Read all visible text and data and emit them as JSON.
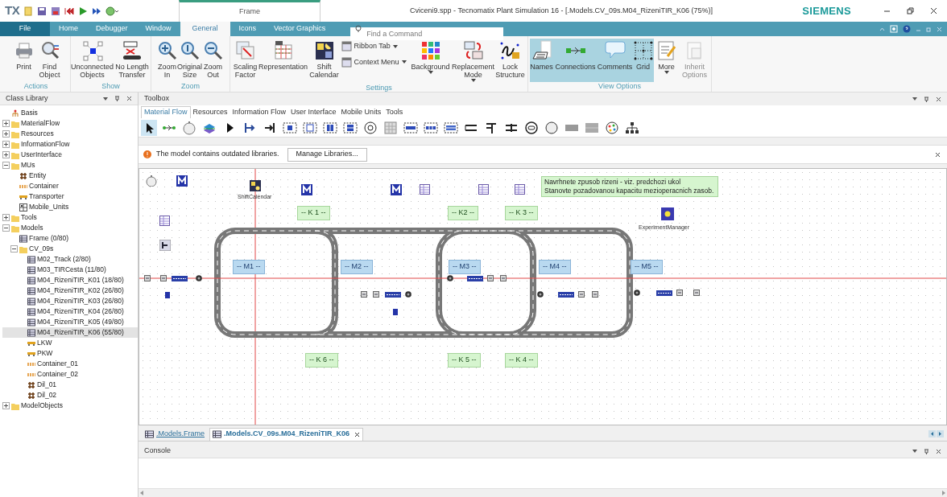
{
  "title_bar": {
    "logo": "TX",
    "contextual_tab": "Frame",
    "title": "Cviceni9.spp - Tecnomatix Plant Simulation 16 - [.Models.CV_09s.M04_RizeniTIR_K06  (75%)]",
    "brand": "SIEMENS"
  },
  "ribbon": {
    "tabs": [
      {
        "label": "File",
        "kind": "file",
        "selected": false
      },
      {
        "label": "Home",
        "kind": "tab",
        "selected": false
      },
      {
        "label": "Debugger",
        "kind": "tab",
        "selected": false
      },
      {
        "label": "Window",
        "kind": "tab",
        "selected": false
      },
      {
        "label": "General",
        "kind": "tab",
        "selected": true
      },
      {
        "label": "Icons",
        "kind": "tab",
        "selected": false
      },
      {
        "label": "Vector Graphics",
        "kind": "tab",
        "selected": false
      }
    ],
    "search": {
      "placeholder": "Find a Command"
    },
    "groups": [
      {
        "label": "Actions",
        "items": [
          {
            "kind": "large",
            "label": "Print"
          },
          {
            "kind": "large",
            "label": "Find Object"
          }
        ]
      },
      {
        "label": "Show",
        "items": [
          {
            "kind": "large",
            "label": "Unconnected Objects"
          },
          {
            "kind": "large",
            "label": "No Length Transfer"
          }
        ]
      },
      {
        "label": "Zoom",
        "items": [
          {
            "kind": "large",
            "label": "Zoom In"
          },
          {
            "kind": "large",
            "label": "Original Size"
          },
          {
            "kind": "large",
            "label": "Zoom Out"
          }
        ]
      },
      {
        "label": "Settings",
        "items": [
          {
            "kind": "large",
            "label": "Scaling Factor"
          },
          {
            "kind": "large",
            "label": "Representation"
          },
          {
            "kind": "large",
            "label": "Shift Calendar"
          },
          {
            "kind": "small",
            "label": "Ribbon Tab"
          },
          {
            "kind": "small",
            "label": "Context Menu"
          },
          {
            "kind": "large-dropdown",
            "label": "Background"
          },
          {
            "kind": "large-dropdown",
            "label": "Replacement Mode"
          },
          {
            "kind": "large",
            "label": "Lock Structure"
          }
        ]
      },
      {
        "label": "View Options",
        "items": [
          {
            "kind": "large",
            "label": "Names",
            "selected": true,
            "disabled": false
          },
          {
            "kind": "large",
            "label": "Connections",
            "selected": true,
            "disabled": false
          },
          {
            "kind": "large",
            "label": "Comments",
            "selected": true,
            "disabled": false
          },
          {
            "kind": "large",
            "label": "Grid",
            "selected": true,
            "disabled": false
          },
          {
            "kind": "large-dropdown",
            "label": "More",
            "selected": false,
            "disabled": false
          },
          {
            "kind": "large",
            "label": "Inherit Options",
            "selected": false,
            "disabled": true
          }
        ]
      }
    ]
  },
  "class_library": {
    "title": "Class Library",
    "tree": [
      {
        "label": "Basis",
        "kind": "library",
        "selected": false
      },
      {
        "label": "MaterialFlow",
        "kind": "folder",
        "expanded": false,
        "selected": false
      },
      {
        "label": "Resources",
        "kind": "folder",
        "expanded": false,
        "selected": false
      },
      {
        "label": "InformationFlow",
        "kind": "folder",
        "expanded": false,
        "selected": false
      },
      {
        "label": "UserInterface",
        "kind": "folder",
        "expanded": false,
        "selected": false
      },
      {
        "label": "MUs",
        "kind": "folder",
        "expanded": true,
        "selected": false,
        "children": [
          {
            "label": "Entity",
            "kind": "entity",
            "selected": false
          },
          {
            "label": "Container",
            "kind": "container",
            "selected": false
          },
          {
            "label": "Transporter",
            "kind": "transporter",
            "selected": false
          },
          {
            "label": "Mobile_Units",
            "kind": "mu-folder",
            "selected": false
          }
        ]
      },
      {
        "label": "Tools",
        "kind": "folder",
        "expanded": false,
        "selected": false
      },
      {
        "label": "Models",
        "kind": "folder",
        "expanded": true,
        "selected": false,
        "children": [
          {
            "label": "Frame (0/80)",
            "kind": "frame",
            "selected": false
          },
          {
            "label": "CV_09s",
            "kind": "folder",
            "expanded": true,
            "selected": false,
            "children": [
              {
                "label": "M02_Track (2/80)",
                "kind": "frame",
                "selected": false
              },
              {
                "label": "M03_TIRCesta (11/80)",
                "kind": "frame",
                "selected": false
              },
              {
                "label": "M04_RizeniTIR_K01 (18/80)",
                "kind": "frame",
                "selected": false
              },
              {
                "label": "M04_RizeniTIR_K02 (26/80)",
                "kind": "frame",
                "selected": false
              },
              {
                "label": "M04_RizeniTIR_K03 (26/80)",
                "kind": "frame",
                "selected": false
              },
              {
                "label": "M04_RizeniTIR_K04 (26/80)",
                "kind": "frame",
                "selected": false
              },
              {
                "label": "M04_RizeniTIR_K05 (49/80)",
                "kind": "frame",
                "selected": false
              },
              {
                "label": "M04_RizeniTIR_K06 (55/80)",
                "kind": "frame",
                "selected": true
              },
              {
                "label": "LKW",
                "kind": "transporter",
                "selected": false
              },
              {
                "label": "PKW",
                "kind": "transporter",
                "selected": false
              },
              {
                "label": "Container_01",
                "kind": "container",
                "selected": false
              },
              {
                "label": "Container_02",
                "kind": "container",
                "selected": false
              },
              {
                "label": "Dil_01",
                "kind": "entity",
                "selected": false
              },
              {
                "label": "Dil_02",
                "kind": "entity",
                "selected": false
              }
            ]
          }
        ]
      },
      {
        "label": "ModelObjects",
        "kind": "folder",
        "expanded": false,
        "selected": false
      }
    ]
  },
  "toolbox": {
    "title": "Toolbox",
    "tabs": [
      {
        "label": "Material Flow",
        "selected": true
      },
      {
        "label": "Resources",
        "selected": false
      },
      {
        "label": "Information Flow",
        "selected": false
      },
      {
        "label": "User Interface",
        "selected": false
      },
      {
        "label": "Mobile Units",
        "selected": false
      },
      {
        "label": "Tools",
        "selected": false
      }
    ],
    "tools": [
      {
        "selected": true
      },
      {
        "selected": false
      },
      {
        "selected": false
      },
      {
        "selected": false
      },
      {
        "selected": false
      },
      {
        "selected": false
      },
      {
        "selected": false
      },
      {
        "selected": false
      },
      {
        "selected": false
      },
      {
        "selected": false
      },
      {
        "selected": false
      },
      {
        "selected": false
      },
      {
        "selected": false
      },
      {
        "selected": false
      },
      {
        "selected": false
      },
      {
        "selected": false
      },
      {
        "selected": false
      },
      {
        "selected": false
      },
      {
        "selected": false
      },
      {
        "selected": false
      },
      {
        "selected": false
      },
      {
        "selected": false
      },
      {
        "selected": false
      },
      {
        "selected": false
      },
      {
        "selected": false
      }
    ]
  },
  "info_bar": {
    "message": "The model contains outdated libraries.",
    "button": "Manage Libraries..."
  },
  "canvas": {
    "labels": [
      {
        "kind": "buffer",
        "text": "-- K 1 --"
      },
      {
        "kind": "buffer",
        "text": "-- K2 --"
      },
      {
        "kind": "buffer",
        "text": "-- K 3 --"
      },
      {
        "kind": "machine",
        "text": "-- M1 --"
      },
      {
        "kind": "machine",
        "text": "-- M2 --"
      },
      {
        "kind": "machine",
        "text": "-- M3 --"
      },
      {
        "kind": "machine",
        "text": "-- M4 --"
      },
      {
        "kind": "machine",
        "text": "-- M5 --"
      },
      {
        "kind": "buffer",
        "text": "-- K 6 --"
      },
      {
        "kind": "buffer",
        "text": "-- K 5 --"
      },
      {
        "kind": "buffer",
        "text": "-- K 4 --"
      }
    ],
    "note": [
      "Navrhnete zpusob rizeni - viz. predchozi ukol",
      "Stanovte pozadovanou kapacitu mezioperacnich zasob."
    ],
    "captions": [
      "ShiftCalendar",
      "ExperimentManager"
    ]
  },
  "document_tabs": [
    {
      "label": ".Models.Frame",
      "selected": false
    },
    {
      "label": ".Models.CV_09s.M04_RizeniTIR_K06",
      "selected": true
    }
  ],
  "console": {
    "title": "Console"
  }
}
